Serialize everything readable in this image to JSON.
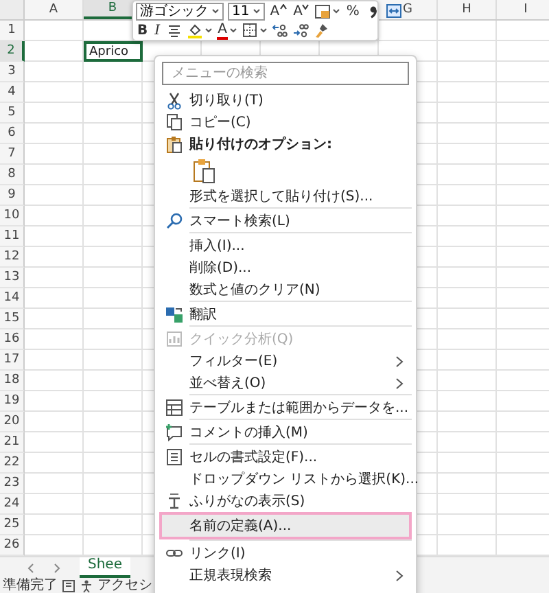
{
  "sheet": {
    "columns_left": [
      {
        "label": "A",
        "selected": false
      },
      {
        "label": "B",
        "selected": true
      }
    ],
    "columns_right": [
      {
        "label": "G",
        "selected": false
      },
      {
        "label": "H",
        "selected": false
      },
      {
        "label": "I",
        "selected": false
      }
    ],
    "rows": [
      {
        "label": "1",
        "selected": false
      },
      {
        "label": "2",
        "selected": true,
        "cells": [
          {},
          {
            "text": "Aprico",
            "selected": true
          }
        ]
      },
      {
        "label": "3",
        "selected": false
      },
      {
        "label": "4",
        "selected": false
      },
      {
        "label": "5",
        "selected": false
      },
      {
        "label": "6",
        "selected": false
      },
      {
        "label": "7",
        "selected": false
      },
      {
        "label": "8",
        "selected": false
      },
      {
        "label": "9",
        "selected": false
      },
      {
        "label": "10",
        "selected": false
      },
      {
        "label": "11",
        "selected": false
      },
      {
        "label": "12",
        "selected": false
      },
      {
        "label": "13",
        "selected": false
      },
      {
        "label": "14",
        "selected": false
      },
      {
        "label": "15",
        "selected": false
      },
      {
        "label": "16",
        "selected": false
      },
      {
        "label": "17",
        "selected": false
      },
      {
        "label": "18",
        "selected": false
      },
      {
        "label": "19",
        "selected": false
      },
      {
        "label": "20",
        "selected": false
      },
      {
        "label": "21",
        "selected": false
      },
      {
        "label": "22",
        "selected": false
      },
      {
        "label": "23",
        "selected": false
      },
      {
        "label": "24",
        "selected": false
      },
      {
        "label": "25",
        "selected": false
      },
      {
        "label": "26",
        "selected": false
      }
    ]
  },
  "sheet_tabs": [
    {
      "label": "Shee",
      "selected": true
    }
  ],
  "status_bar": {
    "ready": "準備完了",
    "accessibility": "アクセシ"
  },
  "mini_toolbar": {
    "font_box": "游ゴシック",
    "size_box": "11",
    "row1": [
      {
        "kind": "grow",
        "label": "A"
      },
      {
        "kind": "shrink",
        "label": "A"
      },
      {
        "kind": "styles",
        "dropdown": true
      },
      {
        "kind": "percent",
        "label": "%"
      },
      {
        "kind": "comma"
      },
      {
        "kind": "merge"
      }
    ],
    "row2": [
      {
        "kind": "bold",
        "label": "B"
      },
      {
        "kind": "italic",
        "label": "I"
      },
      {
        "kind": "align"
      },
      {
        "kind": "fill",
        "dropdown": true
      },
      {
        "kind": "fontcolor",
        "label": "A",
        "dropdown": true
      },
      {
        "kind": "borders",
        "dropdown": true
      },
      {
        "kind": "incdec"
      },
      {
        "kind": "decdec"
      },
      {
        "kind": "painter"
      }
    ]
  },
  "context_menu": [
    {
      "kind": "search",
      "placeholder": "メニューの検索"
    },
    {
      "kind": "item",
      "label": "切り取り(T)"
    },
    {
      "kind": "item",
      "label": "コピー(C)"
    },
    {
      "kind": "header",
      "label": "貼り付けのオプション:"
    },
    {
      "kind": "paste_options"
    },
    {
      "kind": "item",
      "label": "形式を選択して貼り付け(S)..."
    },
    {
      "kind": "divider"
    },
    {
      "kind": "item",
      "label": "スマート検索(L)"
    },
    {
      "kind": "divider"
    },
    {
      "kind": "item",
      "label": "挿入(I)..."
    },
    {
      "kind": "item",
      "label": "削除(D)..."
    },
    {
      "kind": "item",
      "label": "数式と値のクリア(N)"
    },
    {
      "kind": "divider"
    },
    {
      "kind": "item",
      "label": "翻訳"
    },
    {
      "kind": "divider"
    },
    {
      "kind": "item",
      "label": "クイック分析(Q)",
      "disabled": true
    },
    {
      "kind": "item",
      "label": "フィルター(E)",
      "submenu": true
    },
    {
      "kind": "item",
      "label": "並べ替え(O)",
      "submenu": true
    },
    {
      "kind": "divider"
    },
    {
      "kind": "item",
      "label": "テーブルまたは範囲からデータを..."
    },
    {
      "kind": "divider"
    },
    {
      "kind": "item",
      "label": "コメントの挿入(M)"
    },
    {
      "kind": "divider"
    },
    {
      "kind": "item",
      "label": "セルの書式設定(F)..."
    },
    {
      "kind": "item",
      "label": "ドロップダウン リストから選択(K)..."
    },
    {
      "kind": "item",
      "label": "ふりがなの表示(S)"
    },
    {
      "kind": "item",
      "label": "名前の定義(A)...",
      "hovered": true,
      "annotated": true
    },
    {
      "kind": "divider"
    },
    {
      "kind": "item",
      "label": "リンク(I)"
    },
    {
      "kind": "item",
      "label": "正規表現検索",
      "submenu": true
    }
  ]
}
